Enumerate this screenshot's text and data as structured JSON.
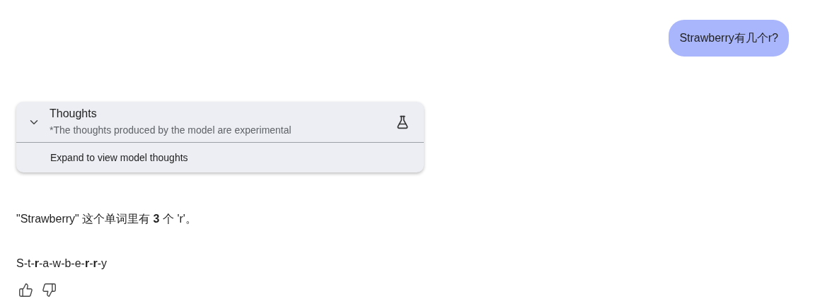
{
  "user_message": {
    "text": "Strawberry有几个r?"
  },
  "thoughts": {
    "title": "Thoughts",
    "subtitle": "*The thoughts produced by the model are experimental",
    "expand_label": "Expand to view model thoughts"
  },
  "answer": {
    "paragraphs": [
      "\"Strawberry\" 这个单词里有 **3** 个 'r'。",
      "S-t-**r**-a-w-b-e-**r**-**r**-y"
    ]
  }
}
